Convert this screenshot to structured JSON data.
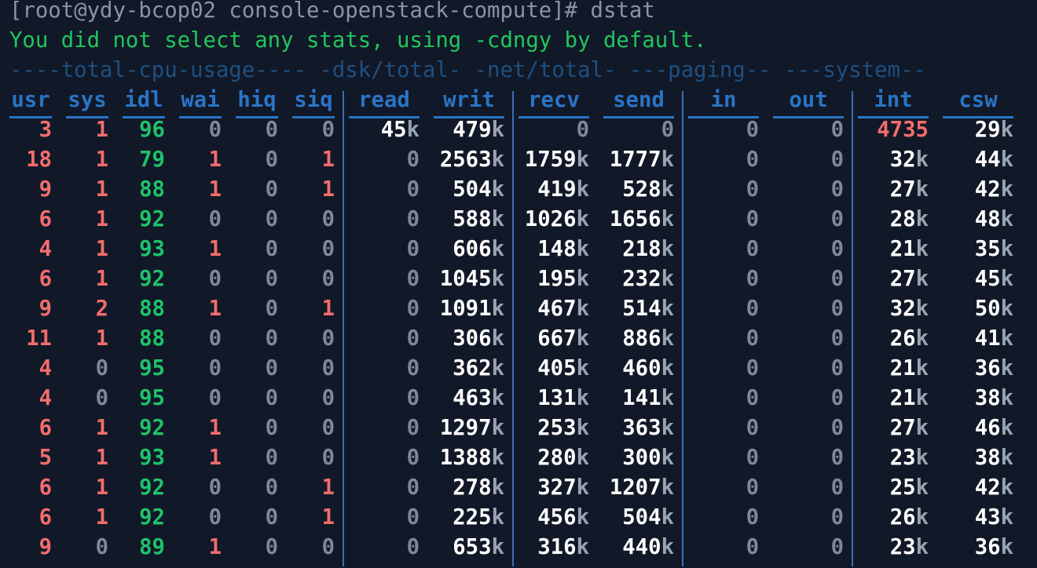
{
  "prompt": "[root@ydy-bcop02 console-openstack-compute]# dstat",
  "message": "You did not select any stats, using -cdngy by default.",
  "groups": "----total-cpu-usage---- -dsk/total- -net/total- ---paging-- ---system--",
  "headers": [
    "usr",
    "sys",
    "idl",
    "wai",
    "hiq",
    "siq",
    "read",
    "writ",
    "recv",
    "send",
    "in",
    "out",
    "int",
    "csw"
  ],
  "rows": [
    [
      "3",
      "1",
      "96",
      "0",
      "0",
      "0",
      "45k",
      "479k",
      "0",
      "0",
      "0",
      "0",
      "4735",
      "29k"
    ],
    [
      "18",
      "1",
      "79",
      "1",
      "0",
      "1",
      "0",
      "2563k",
      "1759k",
      "1777k",
      "0",
      "0",
      "32k",
      "44k"
    ],
    [
      "9",
      "1",
      "88",
      "1",
      "0",
      "1",
      "0",
      "504k",
      "419k",
      "528k",
      "0",
      "0",
      "27k",
      "42k"
    ],
    [
      "6",
      "1",
      "92",
      "0",
      "0",
      "0",
      "0",
      "588k",
      "1026k",
      "1656k",
      "0",
      "0",
      "28k",
      "48k"
    ],
    [
      "4",
      "1",
      "93",
      "1",
      "0",
      "0",
      "0",
      "606k",
      "148k",
      "218k",
      "0",
      "0",
      "21k",
      "35k"
    ],
    [
      "6",
      "1",
      "92",
      "0",
      "0",
      "0",
      "0",
      "1045k",
      "195k",
      "232k",
      "0",
      "0",
      "27k",
      "45k"
    ],
    [
      "9",
      "2",
      "88",
      "1",
      "0",
      "1",
      "0",
      "1091k",
      "467k",
      "514k",
      "0",
      "0",
      "32k",
      "50k"
    ],
    [
      "11",
      "1",
      "88",
      "0",
      "0",
      "0",
      "0",
      "306k",
      "667k",
      "886k",
      "0",
      "0",
      "26k",
      "41k"
    ],
    [
      "4",
      "0",
      "95",
      "0",
      "0",
      "0",
      "0",
      "362k",
      "405k",
      "460k",
      "0",
      "0",
      "21k",
      "36k"
    ],
    [
      "4",
      "0",
      "95",
      "0",
      "0",
      "0",
      "0",
      "463k",
      "131k",
      "141k",
      "0",
      "0",
      "21k",
      "38k"
    ],
    [
      "6",
      "1",
      "92",
      "1",
      "0",
      "0",
      "0",
      "1297k",
      "253k",
      "363k",
      "0",
      "0",
      "27k",
      "46k"
    ],
    [
      "5",
      "1",
      "93",
      "1",
      "0",
      "0",
      "0",
      "1388k",
      "280k",
      "300k",
      "0",
      "0",
      "23k",
      "38k"
    ],
    [
      "6",
      "1",
      "92",
      "0",
      "0",
      "1",
      "0",
      "278k",
      "327k",
      "1207k",
      "0",
      "0",
      "25k",
      "42k"
    ],
    [
      "6",
      "1",
      "92",
      "0",
      "0",
      "1",
      "0",
      "225k",
      "456k",
      "504k",
      "0",
      "0",
      "26k",
      "43k"
    ],
    [
      "9",
      "0",
      "89",
      "1",
      "0",
      "0",
      "0",
      "653k",
      "316k",
      "440k",
      "0",
      "0",
      "23k",
      "36k"
    ]
  ]
}
